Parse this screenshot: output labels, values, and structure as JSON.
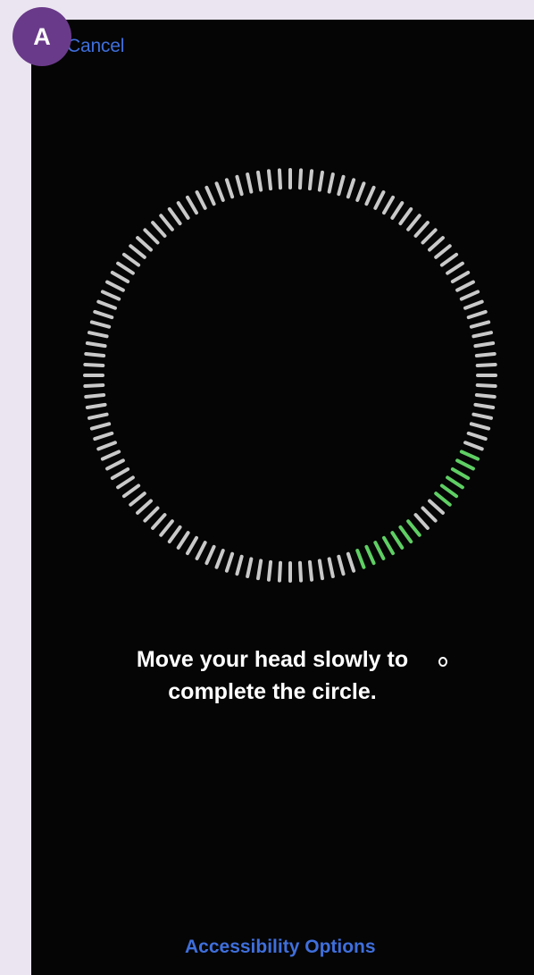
{
  "header": {
    "cancel_label": "Cancel",
    "badge_letter": "A"
  },
  "enrollment": {
    "instruction_line1": "Move your head slowly to",
    "instruction_line2": "complete the circle.",
    "tick_count": 120,
    "tick_color": "#c9c9c9",
    "progress_color": "#5fcf64",
    "progress_fraction": 0.13
  },
  "footer": {
    "accessibility_label": "Accessibility Options"
  },
  "colors": {
    "link": "#3f6fdc",
    "screen_bg": "#050505",
    "badge_bg": "#6a3a8a",
    "page_bg": "#ebe5f1"
  }
}
